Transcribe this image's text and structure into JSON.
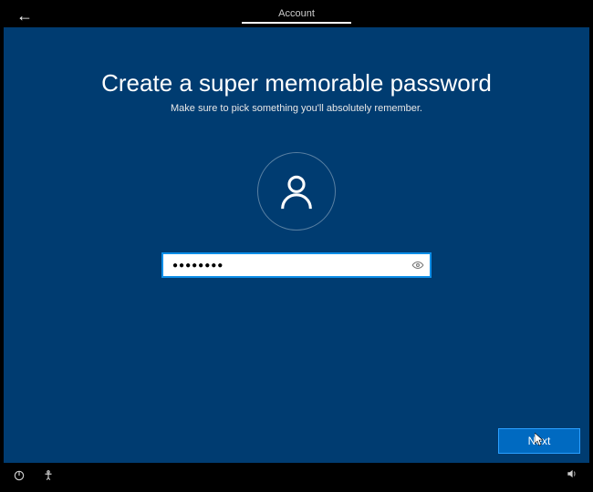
{
  "header": {
    "tab_label": "Account"
  },
  "main": {
    "title": "Create a super memorable password",
    "subtitle": "Make sure to pick something you'll absolutely remember.",
    "password_value": "●●●●●●●●",
    "next_button_label": "Next"
  },
  "colors": {
    "panel_bg": "#003c71",
    "accent": "#006ac1",
    "focus_border": "#0c8ee8"
  }
}
